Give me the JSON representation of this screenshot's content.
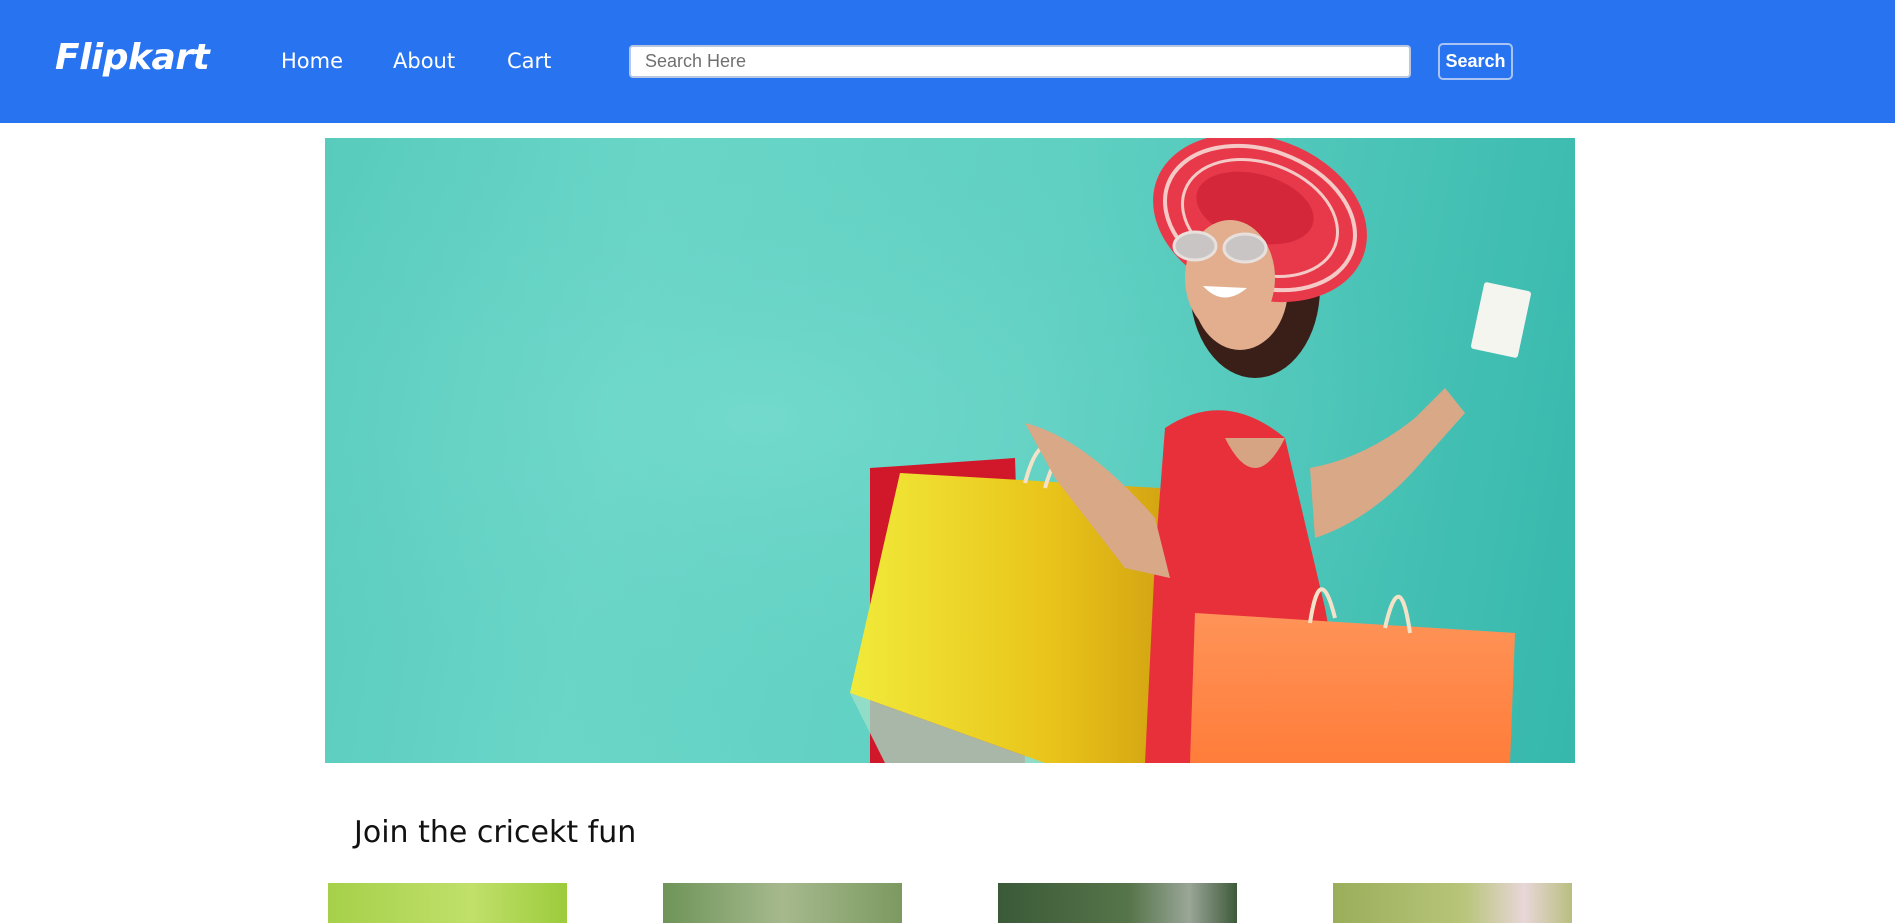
{
  "navbar": {
    "brand": "Flipkart",
    "links": [
      "Home",
      "About",
      "Cart"
    ],
    "search_placeholder": "Search Here",
    "search_button": "Search",
    "bg_color": "#2874f0"
  },
  "hero": {
    "image": "woman-with-shopping-bags-photo"
  },
  "section": {
    "title": "Join the cricekt fun",
    "thumbnails": [
      "cricket-photo",
      "cricket-photo",
      "cricket-photo",
      "cricket-photo"
    ]
  }
}
